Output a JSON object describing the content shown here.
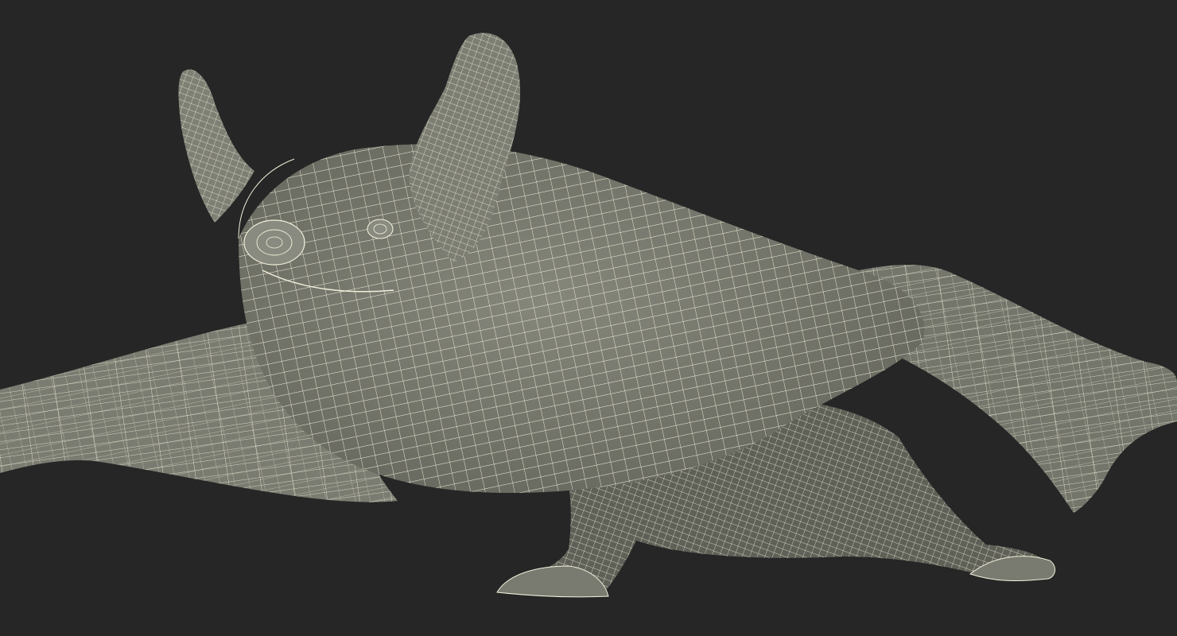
{
  "scene": {
    "subject": "bat-3d-wireframe-model",
    "background_color": "#262626",
    "mesh_fill_color": "#7a7b70",
    "mesh_shadow_color": "#5c5d54",
    "wire_color": "#f2f0dc"
  }
}
